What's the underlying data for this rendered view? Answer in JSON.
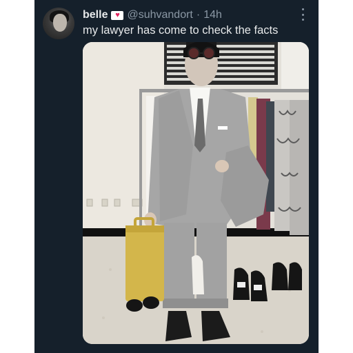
{
  "author": {
    "display_name": "belle",
    "badge": "heart",
    "handle": "@suhvandort",
    "separator": "·",
    "timestamp": "14h"
  },
  "tweet": {
    "text": "my lawyer has come to check the facts"
  },
  "icons": {
    "more": "more-icon",
    "badge": "heart-badge-icon"
  },
  "colors": {
    "background": "#15202b",
    "text_primary": "#e7e9ea",
    "text_secondary": "#8b98a5",
    "badge_heart": "#e0245e"
  }
}
